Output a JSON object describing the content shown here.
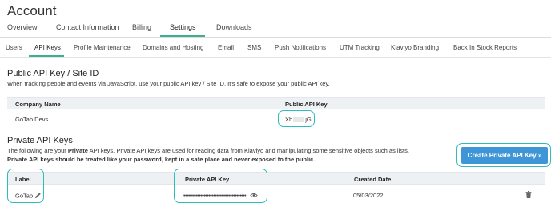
{
  "page": {
    "title": "Account"
  },
  "main_tabs": [
    {
      "label": "Overview"
    },
    {
      "label": "Contact Information"
    },
    {
      "label": "Billing"
    },
    {
      "label": "Settings"
    },
    {
      "label": "Downloads"
    }
  ],
  "sub_tabs": [
    {
      "label": "Users"
    },
    {
      "label": "API Keys"
    },
    {
      "label": "Profile Maintenance"
    },
    {
      "label": "Domains and Hosting"
    },
    {
      "label": "Email"
    },
    {
      "label": "SMS"
    },
    {
      "label": "Push Notifications"
    },
    {
      "label": "UTM Tracking"
    },
    {
      "label": "Klaviyo Branding"
    },
    {
      "label": "Back In Stock Reports"
    }
  ],
  "public_section": {
    "title": "Public API Key / Site ID",
    "description": "When tracking people and events via JavaScript, use your public API key / Site ID. It's safe to expose your public API key.",
    "col_company": "Company Name",
    "col_key": "Public API Key",
    "company": "GoTab Devs",
    "key_start": "Xh",
    "key_end": "jG"
  },
  "private_section": {
    "title": "Private API Keys",
    "desc_part1": "The following are your ",
    "desc_bold": "Private",
    "desc_part2": " API keys. Private API keys are used for reading data from Klaviyo and manipulating some sensitive objects such as lists.",
    "desc_warning": "Private API keys should be treated like your password, kept in a safe place and never exposed to the public.",
    "create_button": "Create Private API Key »",
    "col_label": "Label",
    "col_key": "Private API Key",
    "col_created": "Created Date",
    "row_label": "GoTab",
    "row_key_masked": "••••••••••••••••••••••••••••••••••••••••",
    "row_created": "05/03/2022"
  },
  "icons": {
    "edit": "pencil-icon",
    "reveal": "eye-icon",
    "delete": "trash-icon"
  },
  "colors": {
    "accent": "#3fae8f",
    "button": "#3f96d6",
    "highlight": "#2ebcb8"
  }
}
